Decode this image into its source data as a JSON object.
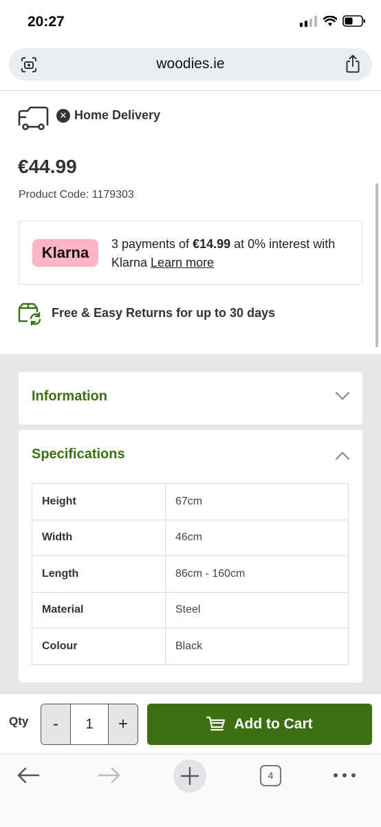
{
  "status_bar": {
    "time": "20:27"
  },
  "browser": {
    "url": "woodies.ie",
    "tab_count": "4"
  },
  "delivery": {
    "label": "Home Delivery",
    "status": "unavailable"
  },
  "product": {
    "price": "€44.99",
    "code_label": "Product Code: 1179303"
  },
  "klarna": {
    "logo": "Klarna",
    "text_before": "3 payments of ",
    "amount": "€14.99",
    "text_after": " at 0% interest with Klarna ",
    "link": "Learn more"
  },
  "returns": {
    "label": "Free & Easy Returns for up to 30 days"
  },
  "sections": {
    "information": {
      "title": "Information",
      "expanded": false
    },
    "specifications": {
      "title": "Specifications",
      "expanded": true
    }
  },
  "specifications": [
    {
      "key": "Height",
      "value": "67cm"
    },
    {
      "key": "Width",
      "value": "46cm"
    },
    {
      "key": "Length",
      "value": "86cm - 160cm"
    },
    {
      "key": "Material",
      "value": "Steel"
    },
    {
      "key": "Colour",
      "value": "Black"
    }
  ],
  "cart": {
    "qty_label": "Qty",
    "minus": "-",
    "quantity": "1",
    "plus": "+",
    "add_label": "Add to Cart"
  },
  "colors": {
    "brand_green": "#3c6e12",
    "klarna_pink": "#ffb3c7"
  },
  "icons": [
    "wifi-icon",
    "battery-icon",
    "cellular-icon",
    "page-settings-icon",
    "share-icon",
    "delivery-truck-icon",
    "x-circle-icon",
    "returns-box-icon",
    "chevron-down-icon",
    "chevron-up-icon",
    "cart-icon",
    "back-arrow-icon",
    "forward-arrow-icon",
    "new-tab-plus-icon",
    "tabs-icon",
    "more-icon"
  ]
}
